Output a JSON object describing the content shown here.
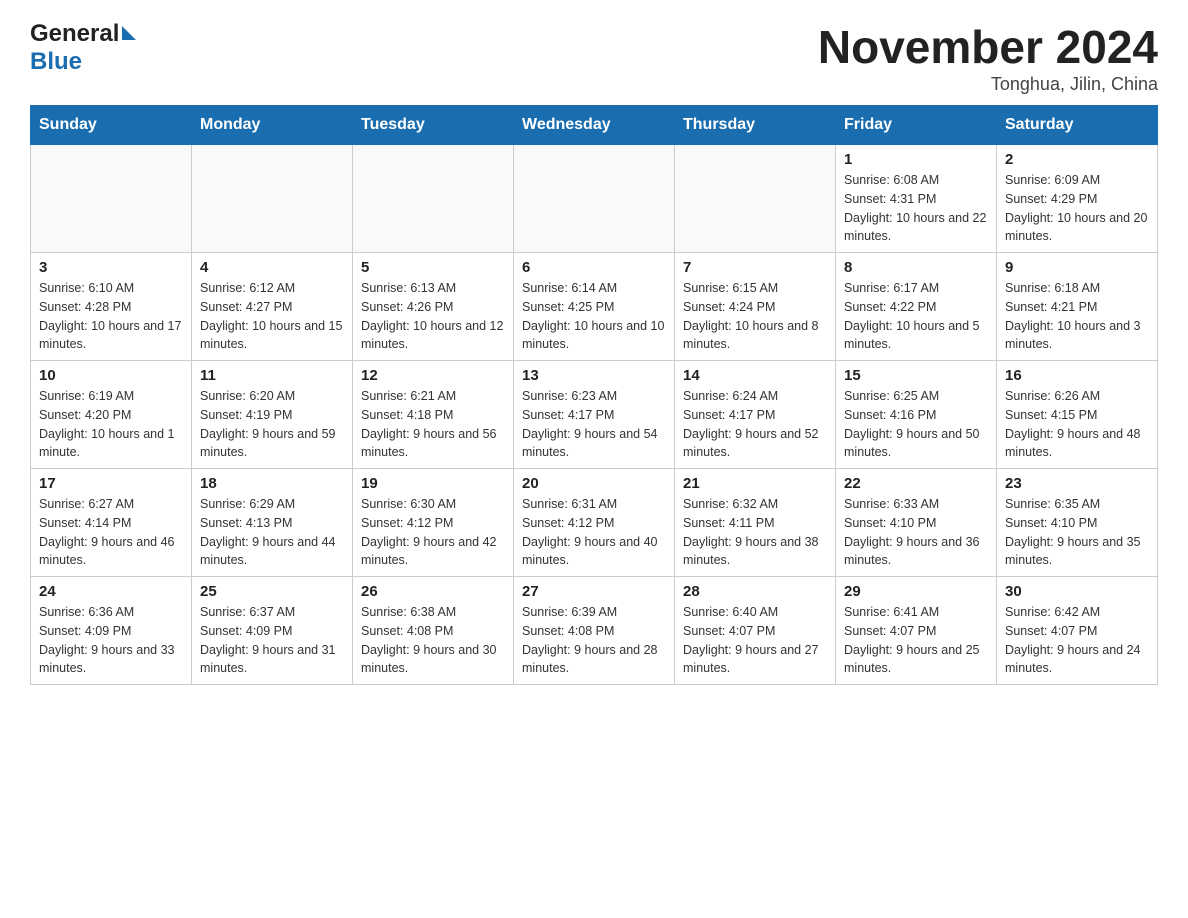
{
  "header": {
    "logo_general": "General",
    "logo_blue": "Blue",
    "month_title": "November 2024",
    "location": "Tonghua, Jilin, China"
  },
  "weekdays": [
    "Sunday",
    "Monday",
    "Tuesday",
    "Wednesday",
    "Thursday",
    "Friday",
    "Saturday"
  ],
  "weeks": [
    [
      {
        "day": "",
        "sunrise": "",
        "sunset": "",
        "daylight": ""
      },
      {
        "day": "",
        "sunrise": "",
        "sunset": "",
        "daylight": ""
      },
      {
        "day": "",
        "sunrise": "",
        "sunset": "",
        "daylight": ""
      },
      {
        "day": "",
        "sunrise": "",
        "sunset": "",
        "daylight": ""
      },
      {
        "day": "",
        "sunrise": "",
        "sunset": "",
        "daylight": ""
      },
      {
        "day": "1",
        "sunrise": "Sunrise: 6:08 AM",
        "sunset": "Sunset: 4:31 PM",
        "daylight": "Daylight: 10 hours and 22 minutes."
      },
      {
        "day": "2",
        "sunrise": "Sunrise: 6:09 AM",
        "sunset": "Sunset: 4:29 PM",
        "daylight": "Daylight: 10 hours and 20 minutes."
      }
    ],
    [
      {
        "day": "3",
        "sunrise": "Sunrise: 6:10 AM",
        "sunset": "Sunset: 4:28 PM",
        "daylight": "Daylight: 10 hours and 17 minutes."
      },
      {
        "day": "4",
        "sunrise": "Sunrise: 6:12 AM",
        "sunset": "Sunset: 4:27 PM",
        "daylight": "Daylight: 10 hours and 15 minutes."
      },
      {
        "day": "5",
        "sunrise": "Sunrise: 6:13 AM",
        "sunset": "Sunset: 4:26 PM",
        "daylight": "Daylight: 10 hours and 12 minutes."
      },
      {
        "day": "6",
        "sunrise": "Sunrise: 6:14 AM",
        "sunset": "Sunset: 4:25 PM",
        "daylight": "Daylight: 10 hours and 10 minutes."
      },
      {
        "day": "7",
        "sunrise": "Sunrise: 6:15 AM",
        "sunset": "Sunset: 4:24 PM",
        "daylight": "Daylight: 10 hours and 8 minutes."
      },
      {
        "day": "8",
        "sunrise": "Sunrise: 6:17 AM",
        "sunset": "Sunset: 4:22 PM",
        "daylight": "Daylight: 10 hours and 5 minutes."
      },
      {
        "day": "9",
        "sunrise": "Sunrise: 6:18 AM",
        "sunset": "Sunset: 4:21 PM",
        "daylight": "Daylight: 10 hours and 3 minutes."
      }
    ],
    [
      {
        "day": "10",
        "sunrise": "Sunrise: 6:19 AM",
        "sunset": "Sunset: 4:20 PM",
        "daylight": "Daylight: 10 hours and 1 minute."
      },
      {
        "day": "11",
        "sunrise": "Sunrise: 6:20 AM",
        "sunset": "Sunset: 4:19 PM",
        "daylight": "Daylight: 9 hours and 59 minutes."
      },
      {
        "day": "12",
        "sunrise": "Sunrise: 6:21 AM",
        "sunset": "Sunset: 4:18 PM",
        "daylight": "Daylight: 9 hours and 56 minutes."
      },
      {
        "day": "13",
        "sunrise": "Sunrise: 6:23 AM",
        "sunset": "Sunset: 4:17 PM",
        "daylight": "Daylight: 9 hours and 54 minutes."
      },
      {
        "day": "14",
        "sunrise": "Sunrise: 6:24 AM",
        "sunset": "Sunset: 4:17 PM",
        "daylight": "Daylight: 9 hours and 52 minutes."
      },
      {
        "day": "15",
        "sunrise": "Sunrise: 6:25 AM",
        "sunset": "Sunset: 4:16 PM",
        "daylight": "Daylight: 9 hours and 50 minutes."
      },
      {
        "day": "16",
        "sunrise": "Sunrise: 6:26 AM",
        "sunset": "Sunset: 4:15 PM",
        "daylight": "Daylight: 9 hours and 48 minutes."
      }
    ],
    [
      {
        "day": "17",
        "sunrise": "Sunrise: 6:27 AM",
        "sunset": "Sunset: 4:14 PM",
        "daylight": "Daylight: 9 hours and 46 minutes."
      },
      {
        "day": "18",
        "sunrise": "Sunrise: 6:29 AM",
        "sunset": "Sunset: 4:13 PM",
        "daylight": "Daylight: 9 hours and 44 minutes."
      },
      {
        "day": "19",
        "sunrise": "Sunrise: 6:30 AM",
        "sunset": "Sunset: 4:12 PM",
        "daylight": "Daylight: 9 hours and 42 minutes."
      },
      {
        "day": "20",
        "sunrise": "Sunrise: 6:31 AM",
        "sunset": "Sunset: 4:12 PM",
        "daylight": "Daylight: 9 hours and 40 minutes."
      },
      {
        "day": "21",
        "sunrise": "Sunrise: 6:32 AM",
        "sunset": "Sunset: 4:11 PM",
        "daylight": "Daylight: 9 hours and 38 minutes."
      },
      {
        "day": "22",
        "sunrise": "Sunrise: 6:33 AM",
        "sunset": "Sunset: 4:10 PM",
        "daylight": "Daylight: 9 hours and 36 minutes."
      },
      {
        "day": "23",
        "sunrise": "Sunrise: 6:35 AM",
        "sunset": "Sunset: 4:10 PM",
        "daylight": "Daylight: 9 hours and 35 minutes."
      }
    ],
    [
      {
        "day": "24",
        "sunrise": "Sunrise: 6:36 AM",
        "sunset": "Sunset: 4:09 PM",
        "daylight": "Daylight: 9 hours and 33 minutes."
      },
      {
        "day": "25",
        "sunrise": "Sunrise: 6:37 AM",
        "sunset": "Sunset: 4:09 PM",
        "daylight": "Daylight: 9 hours and 31 minutes."
      },
      {
        "day": "26",
        "sunrise": "Sunrise: 6:38 AM",
        "sunset": "Sunset: 4:08 PM",
        "daylight": "Daylight: 9 hours and 30 minutes."
      },
      {
        "day": "27",
        "sunrise": "Sunrise: 6:39 AM",
        "sunset": "Sunset: 4:08 PM",
        "daylight": "Daylight: 9 hours and 28 minutes."
      },
      {
        "day": "28",
        "sunrise": "Sunrise: 6:40 AM",
        "sunset": "Sunset: 4:07 PM",
        "daylight": "Daylight: 9 hours and 27 minutes."
      },
      {
        "day": "29",
        "sunrise": "Sunrise: 6:41 AM",
        "sunset": "Sunset: 4:07 PM",
        "daylight": "Daylight: 9 hours and 25 minutes."
      },
      {
        "day": "30",
        "sunrise": "Sunrise: 6:42 AM",
        "sunset": "Sunset: 4:07 PM",
        "daylight": "Daylight: 9 hours and 24 minutes."
      }
    ]
  ]
}
